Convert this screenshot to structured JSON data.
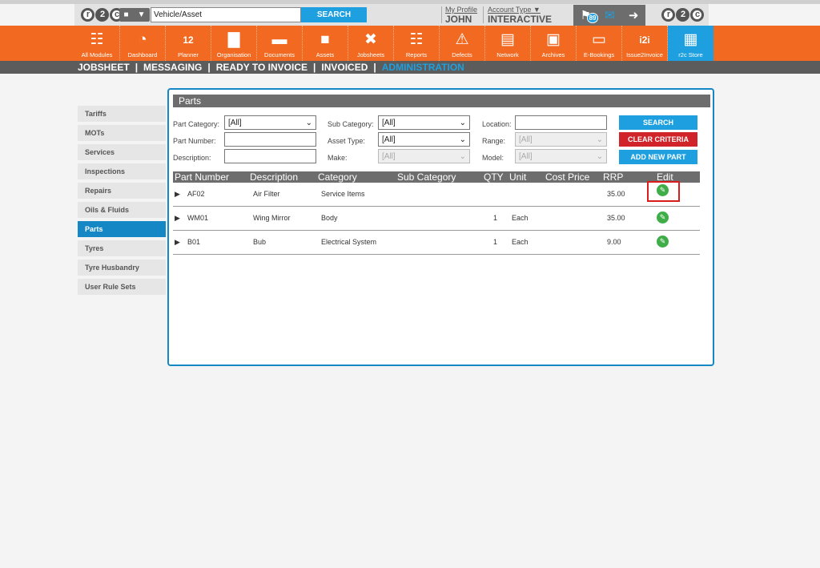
{
  "header": {
    "logo_text": "r2c",
    "vehicle_input": "Vehicle/Asset",
    "search_label": "SEARCH",
    "profile_link": "My Profile",
    "profile_name": "JOHN",
    "account_link": "Account Type",
    "account_value": "INTERACTIVE",
    "notification_count": "89"
  },
  "modules": [
    {
      "label": "All Modules",
      "icon": "grid-icon",
      "glyph": "☷"
    },
    {
      "label": "Dashboard",
      "icon": "speedometer-icon",
      "glyph": "◔"
    },
    {
      "label": "Planner",
      "icon": "calendar-icon",
      "glyph": "12"
    },
    {
      "label": "Organisation",
      "icon": "buildings-icon",
      "glyph": "▇"
    },
    {
      "label": "Documents",
      "icon": "folder-icon",
      "glyph": "▬"
    },
    {
      "label": "Assets",
      "icon": "truck-icon",
      "glyph": "■"
    },
    {
      "label": "Jobsheets",
      "icon": "tools-icon",
      "glyph": "✖"
    },
    {
      "label": "Reports",
      "icon": "clipboard-icon",
      "glyph": "☷"
    },
    {
      "label": "Defects",
      "icon": "warning-icon",
      "glyph": "⚠"
    },
    {
      "label": "Network",
      "icon": "contacts-icon",
      "glyph": "▤"
    },
    {
      "label": "Archives",
      "icon": "archive-icon",
      "glyph": "▣"
    },
    {
      "label": "E-Bookings",
      "icon": "laptop-icon",
      "glyph": "▭"
    },
    {
      "label": "Issue2Invoice",
      "icon": "i2i-icon",
      "glyph": "i2i"
    },
    {
      "label": "r2c Store",
      "icon": "store-icon",
      "glyph": "▦"
    }
  ],
  "subnav": {
    "items": [
      "JOBSHEET",
      "MESSAGING",
      "READY TO INVOICE",
      "INVOICED",
      "ADMINISTRATION"
    ],
    "separator": "|"
  },
  "sidebar": {
    "items": [
      "Tariffs",
      "MOTs",
      "Services",
      "Inspections",
      "Repairs",
      "Oils & Fluids",
      "Parts",
      "Tyres",
      "Tyre Husbandry",
      "User Rule Sets"
    ],
    "active_index": 6
  },
  "panel": {
    "title": "Parts",
    "filters": {
      "part_category_label": "Part Category:",
      "part_category_value": "[All]",
      "sub_category_label": "Sub Category:",
      "sub_category_value": "[All]",
      "location_label": "Location:",
      "location_value": "",
      "part_number_label": "Part Number:",
      "part_number_value": "",
      "asset_type_label": "Asset Type:",
      "asset_type_value": "[All]",
      "range_label": "Range:",
      "range_value": "[All]",
      "description_label": "Description:",
      "description_value": "",
      "make_label": "Make:",
      "make_value": "[All]",
      "model_label": "Model:",
      "model_value": "[All]"
    },
    "buttons": {
      "search": "SEARCH",
      "clear": "CLEAR CRITERIA",
      "add": "ADD NEW PART"
    },
    "table": {
      "columns": [
        "Part Number",
        "Description",
        "Category",
        "Sub Category",
        "QTY",
        "Unit",
        "Cost Price",
        "RRP",
        "Edit"
      ],
      "rows": [
        {
          "part_number": "AF02",
          "description": "Air Filter",
          "category": "Service Items",
          "sub_category": "",
          "qty": "",
          "unit": "",
          "cost_price": "",
          "rrp": "35.00"
        },
        {
          "part_number": "WM01",
          "description": "Wing Mirror",
          "category": "Body",
          "sub_category": "",
          "qty": "1",
          "unit": "Each",
          "cost_price": "",
          "rrp": "35.00"
        },
        {
          "part_number": "B01",
          "description": "Bub",
          "category": "Electrical System",
          "sub_category": "",
          "qty": "1",
          "unit": "Each",
          "cost_price": "",
          "rrp": "9.00"
        }
      ]
    }
  },
  "colors": {
    "brand_orange": "#f26a21",
    "accent_blue": "#1ea0e0",
    "clear_red": "#d0232a",
    "edit_green": "#3fae49",
    "highlight_red": "#d91c1c"
  }
}
